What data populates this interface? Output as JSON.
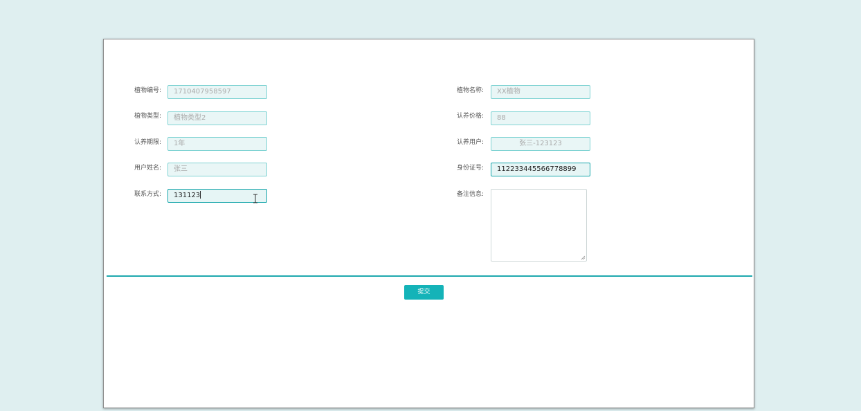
{
  "form": {
    "left": [
      {
        "label": "植物编号:",
        "value": "1710407958597"
      },
      {
        "label": "植物类型:",
        "value": "植物类型2"
      },
      {
        "label": "认养期限:",
        "value": "1年"
      },
      {
        "label": "用户姓名:",
        "value": "张三"
      },
      {
        "label": "联系方式:",
        "value": "131123"
      }
    ],
    "right": [
      {
        "label": "植物名称:",
        "value": "XX植物"
      },
      {
        "label": "认养价格:",
        "value": "88"
      },
      {
        "label": "认养用户:",
        "value": "张三-123123"
      },
      {
        "label": "身份证号:",
        "value": "112233445566778899"
      },
      {
        "label": "备注信息:",
        "value": ""
      }
    ],
    "submit_label": "提交"
  },
  "colors": {
    "accent": "#14b3b8",
    "page_background": "#dfeff0",
    "input_background": "#e9f6f6",
    "input_border": "#7fd3d3"
  }
}
